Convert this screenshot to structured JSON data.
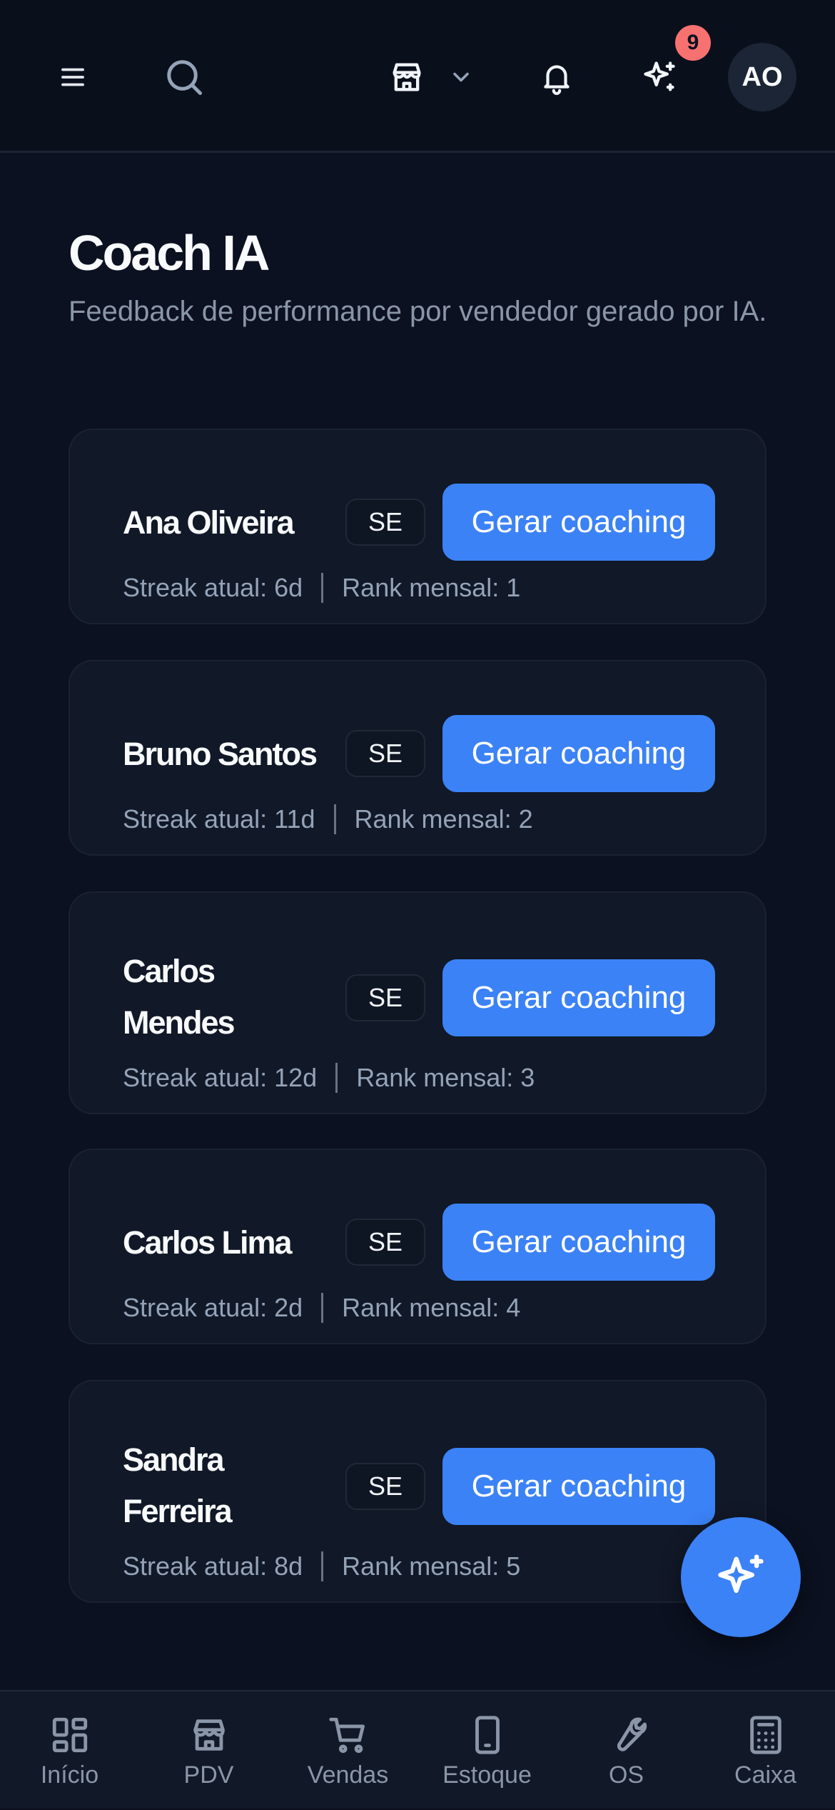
{
  "header": {
    "menu_icon": "menu-icon",
    "search_icon": "search-icon",
    "store_icon": "store-icon",
    "notifications_icon": "bell-icon",
    "ai_icon": "sparkles-icon",
    "ai_badge_count": "9",
    "avatar_initials": "AO"
  },
  "page": {
    "title": "Coach IA",
    "subtitle": "Feedback de performance por vendedor gerado por IA."
  },
  "sellers": [
    {
      "name": "Ana Oliveira",
      "role": "SE",
      "button": "Gerar coaching",
      "streak": "Streak atual: 6d",
      "rank": "Rank mensal: 1"
    },
    {
      "name": "Bruno Santos",
      "role": "SE",
      "button": "Gerar coaching",
      "streak": "Streak atual: 11d",
      "rank": "Rank mensal: 2"
    },
    {
      "name": "Carlos Mendes",
      "role": "SE",
      "button": "Gerar coaching",
      "streak": "Streak atual: 12d",
      "rank": "Rank mensal: 3"
    },
    {
      "name": "Carlos Lima",
      "role": "SE",
      "button": "Gerar coaching",
      "streak": "Streak atual: 2d",
      "rank": "Rank mensal: 4"
    },
    {
      "name": "Sandra Ferreira",
      "role": "SE",
      "button": "Gerar coaching",
      "streak": "Streak atual: 8d",
      "rank": "Rank mensal: 5"
    }
  ],
  "fab": {
    "icon": "sparkles-icon"
  },
  "bottom_nav": [
    {
      "label": "Início",
      "icon": "dashboard-icon"
    },
    {
      "label": "PDV",
      "icon": "store-icon"
    },
    {
      "label": "Vendas",
      "icon": "cart-icon"
    },
    {
      "label": "Estoque",
      "icon": "phone-icon"
    },
    {
      "label": "OS",
      "icon": "wrench-icon"
    },
    {
      "label": "Caixa",
      "icon": "calculator-icon"
    }
  ],
  "colors": {
    "background": "#0b1120",
    "card": "#111827",
    "accent": "#3b82f6",
    "badge": "#f87171",
    "muted_text": "#94a3b8"
  }
}
